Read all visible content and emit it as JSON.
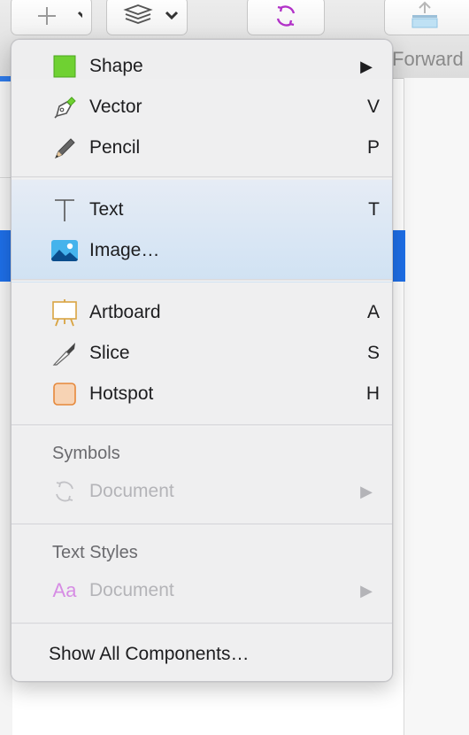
{
  "toolbar": {
    "forward_label": "Forward",
    "icons": [
      "plus-icon",
      "chevron-down-icon",
      "layers-icon",
      "sync-icon",
      "forward-icon"
    ],
    "sync_color": "#b232c8"
  },
  "menu": {
    "items": [
      {
        "label": "Shape",
        "key": "",
        "submenu": true,
        "icon": "shape-icon"
      },
      {
        "label": "Vector",
        "key": "V",
        "icon": "pen-icon"
      },
      {
        "label": "Pencil",
        "key": "P",
        "icon": "pencil-icon"
      },
      {
        "label": "Text",
        "key": "T",
        "icon": "text-icon"
      },
      {
        "label": "Image…",
        "key": "",
        "icon": "image-icon"
      },
      {
        "label": "Artboard",
        "key": "A",
        "icon": "artboard-icon"
      },
      {
        "label": "Slice",
        "key": "S",
        "icon": "slice-icon"
      },
      {
        "label": "Hotspot",
        "key": "H",
        "icon": "hotspot-icon"
      }
    ],
    "symbols": {
      "header": "Symbols",
      "item": "Document",
      "icon": "symbol-sync-icon"
    },
    "text_styles": {
      "header": "Text Styles",
      "item": "Document",
      "icon_text": "Aa"
    },
    "show_all": "Show All Components…",
    "colors": {
      "shape_fill": "#6fd132",
      "hotspot_fill": "#f7d3b4",
      "hotspot_border": "#e6883a",
      "text_style_icon": "#d68ce4",
      "highlight": "#1e6fe8"
    }
  }
}
